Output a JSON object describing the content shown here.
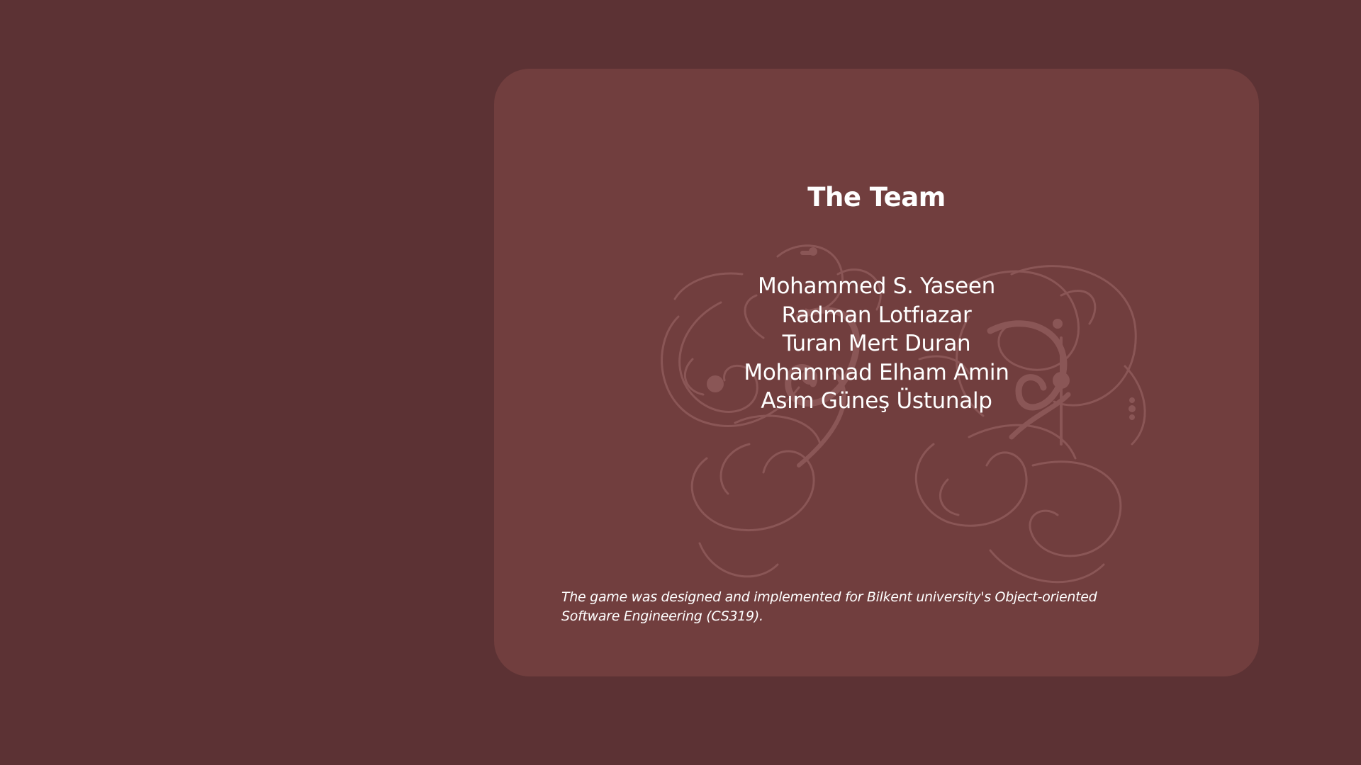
{
  "about": {
    "title": "The Team",
    "members": [
      "Mohammed S. Yaseen",
      "Radman Lotfıazar",
      "Turan Mert Duran",
      "Mohammad Elham Amin",
      "Asım Güneş Üstunalp"
    ],
    "footnote": "The game was designed and implemented for Bilkent university's Object-oriented Software Engineering (CS319)."
  },
  "colors": {
    "background": "#5c3234",
    "card": "#713e3e",
    "ornament": "#8a5656",
    "text": "#ffffff"
  },
  "icons": {
    "ornament": "calligraphic-flourish-ornament"
  }
}
